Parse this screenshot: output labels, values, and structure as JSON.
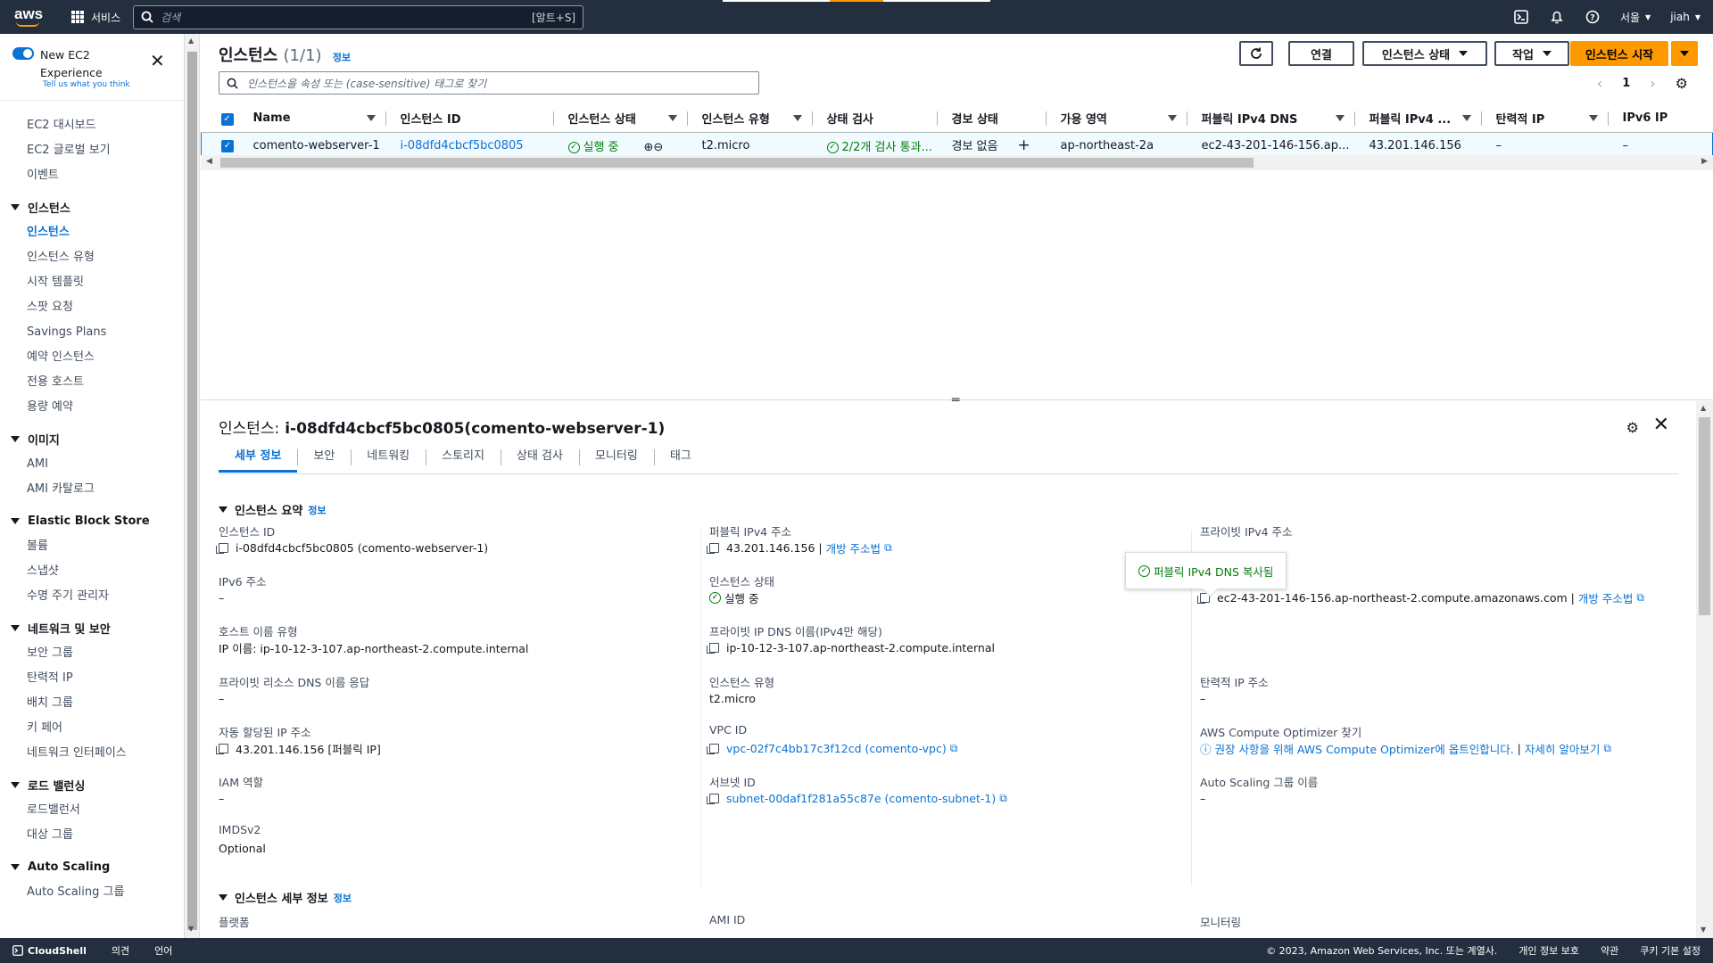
{
  "topnav": {
    "logo": "aws",
    "services": "서비스",
    "search_placeholder": "검색",
    "search_shortcut": "[알트+S]",
    "region": "서울",
    "user": "jiah"
  },
  "sidebar": {
    "new_exp_title": "New EC2 Experience",
    "new_exp_sub": "Tell us what you think",
    "top_links": [
      "EC2 대시보드",
      "EC2 글로벌 보기",
      "이벤트"
    ],
    "groups": [
      {
        "title": "인스턴스",
        "items": [
          "인스턴스",
          "인스턴스 유형",
          "시작 템플릿",
          "스팟 요청",
          "Savings Plans",
          "예약 인스턴스",
          "전용 호스트",
          "용량 예약"
        ]
      },
      {
        "title": "이미지",
        "items": [
          "AMI",
          "AMI 카탈로그"
        ]
      },
      {
        "title": "Elastic Block Store",
        "items": [
          "볼륨",
          "스냅샷",
          "수명 주기 관리자"
        ]
      },
      {
        "title": "네트워크 및 보안",
        "items": [
          "보안 그룹",
          "탄력적 IP",
          "배치 그룹",
          "키 페어",
          "네트워크 인터페이스"
        ]
      },
      {
        "title": "로드 밸런싱",
        "items": [
          "로드밸런서",
          "대상 그룹"
        ]
      },
      {
        "title": "Auto Scaling",
        "items": [
          "Auto Scaling 그룹"
        ]
      }
    ]
  },
  "list": {
    "title": "인스턴스",
    "count": "(1/1)",
    "info": "정보",
    "btn_connect": "연결",
    "btn_state": "인스턴스 상태",
    "btn_actions": "작업",
    "btn_launch": "인스턴스 시작",
    "filter_placeholder": "인스턴스을 속성 또는 (case-sensitive) 태그로 찾기",
    "page": "1",
    "columns": [
      "Name",
      "인스턴스 ID",
      "인스턴스 상태",
      "인스턴스 유형",
      "상태 검사",
      "경보 상태",
      "가용 영역",
      "퍼블릭 IPv4 DNS",
      "퍼블릭 IPv4 ...",
      "탄력적 IP",
      "IPv6 IP"
    ],
    "row": {
      "name": "comento-webserver-1",
      "id": "i-08dfd4cbcf5bc0805",
      "state": "실행 중",
      "type": "t2.micro",
      "check": "2/2개 검사 통과...",
      "alarm": "경보 없음",
      "az": "ap-northeast-2a",
      "dns": "ec2-43-201-146-156.ap...",
      "ip": "43.201.146.156",
      "eip": "–",
      "ipv6": "–"
    }
  },
  "details": {
    "title_prefix": "인스턴스:",
    "title_id": "i-08dfd4cbcf5bc0805(comento-webserver-1)",
    "tabs": [
      "세부 정보",
      "보안",
      "네트워킹",
      "스토리지",
      "상태 검사",
      "모니터링",
      "태그"
    ],
    "section1": "인스턴스 요약",
    "section2": "인스턴스 세부 정보",
    "info": "정보",
    "col1": {
      "id_label": "인스턴스 ID",
      "id_value": "i-08dfd4cbcf5bc0805 (comento-webserver-1)",
      "ipv6_label": "IPv6 주소",
      "ipv6_value": "–",
      "hostname_label": "호스트 이름 유형",
      "hostname_value": "IP 이름: ip-10-12-3-107.ap-northeast-2.compute.internal",
      "rdns_label": "프라이빗 리소스 DNS 이름 응답",
      "rdns_value": "–",
      "autoip_label": "자동 할당된 IP 주소",
      "autoip_value": "43.201.146.156 [퍼블릭 IP]",
      "iam_label": "IAM 역할",
      "iam_value": "–",
      "imds_label": "IMDSv2",
      "imds_value": "Optional",
      "platform_label": "플랫폼"
    },
    "col2": {
      "pubip_label": "퍼블릭 IPv4 주소",
      "pubip_value": "43.201.146.156 |",
      "pubip_link": "개방 주소법",
      "state_label": "인스턴스 상태",
      "state_value": "실행 중",
      "pdns_label": "프라이빗 IP DNS 이름(IPv4만 해당)",
      "pdns_value": "ip-10-12-3-107.ap-northeast-2.compute.internal",
      "type_label": "인스턴스 유형",
      "type_value": "t2.micro",
      "vpc_label": "VPC ID",
      "vpc_value": "vpc-02f7c4bb17c3f12cd (comento-vpc)",
      "subnet_label": "서브넷 ID",
      "subnet_value": "subnet-00daf1f281a55c87e (comento-subnet-1)",
      "ami_label": "AMI ID"
    },
    "col3": {
      "privip_label": "프라이빗 IPv4 주소",
      "pubdns_label": "퍼블릭 IPv4 DNS",
      "pubdns_value": "ec2-43-201-146-156.ap-northeast-2.compute.amazonaws.com |",
      "pubdns_link": "개방 주소법",
      "eip_label": "탄력적 IP 주소",
      "eip_value": "–",
      "opt_label": "AWS Compute Optimizer 찾기",
      "opt_value": "권장 사항을 위해 AWS Compute Optimizer에 옵트인합니다.",
      "opt_link": "자세히 알아보기",
      "asg_label": "Auto Scaling 그룹 이름",
      "asg_value": "–",
      "mon_label": "모니터링"
    },
    "popover": "퍼블릭 IPv4 DNS 복사됨"
  },
  "footer": {
    "cloudshell": "CloudShell",
    "feedback": "의견",
    "language": "언어",
    "copyright": "© 2023, Amazon Web Services, Inc. 또는 계열사.",
    "privacy": "개인 정보 보호",
    "terms": "약관",
    "cookies": "쿠키 기본 설정"
  }
}
